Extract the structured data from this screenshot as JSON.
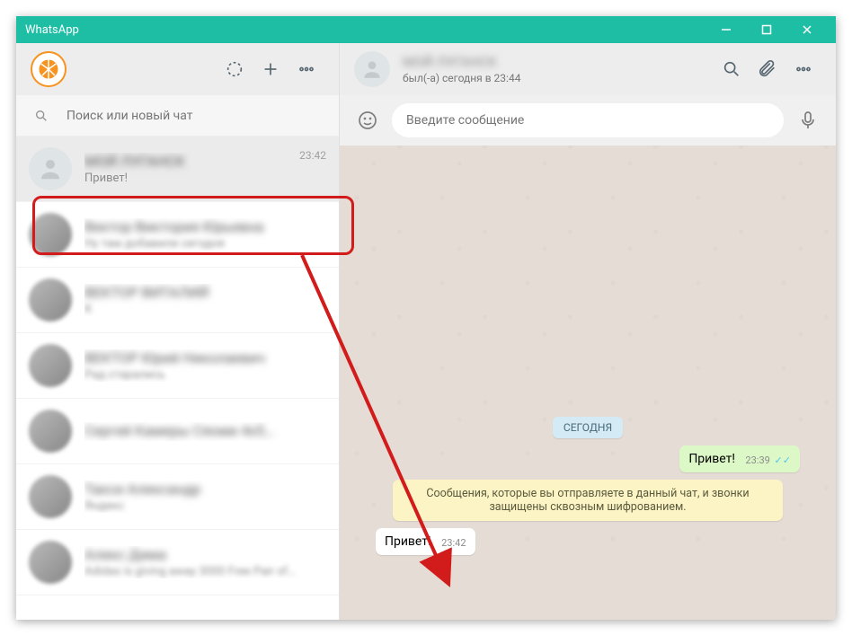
{
  "titlebar": {
    "title": "WhatsApp"
  },
  "search": {
    "placeholder": "Поиск или новый чат"
  },
  "chats": {
    "active": {
      "name": "МОЙ ЛУГАНСК",
      "msg": "Привет!",
      "time": "23:42"
    },
    "others": [
      {
        "name": "Вектор Виктория Юрьевна",
        "msg": "Ну там добавили сегодня",
        "time": ""
      },
      {
        "name": "ВЕКТОР ВИТАЛИЙ",
        "msg": "К",
        "time": ""
      },
      {
        "name": "ВЕКТОР Юрий Николаевич",
        "msg": "Рад старались",
        "time": ""
      },
      {
        "name": "Сергей Камеры Сяоми 4х5…",
        "msg": "",
        "time": ""
      },
      {
        "name": "Такси Александр",
        "msg": "Яндекс",
        "time": ""
      },
      {
        "name": "Алекс Дима",
        "msg": "Adidas is giving away 3000 Free Pair of…",
        "time": ""
      }
    ]
  },
  "chat_header": {
    "name": "МОЙ ЛУГАНСК",
    "status": "был(-а) сегодня в 23:44"
  },
  "chat": {
    "date": "СЕГОДНЯ",
    "out_msg": "Привет!",
    "out_time": "23:39",
    "notice": "Сообщения, которые вы отправляете в данный чат, и звонки защищены сквозным шифрованием.",
    "in_msg": "Привет!",
    "in_time": "23:42"
  },
  "input": {
    "placeholder": "Введите сообщение"
  }
}
